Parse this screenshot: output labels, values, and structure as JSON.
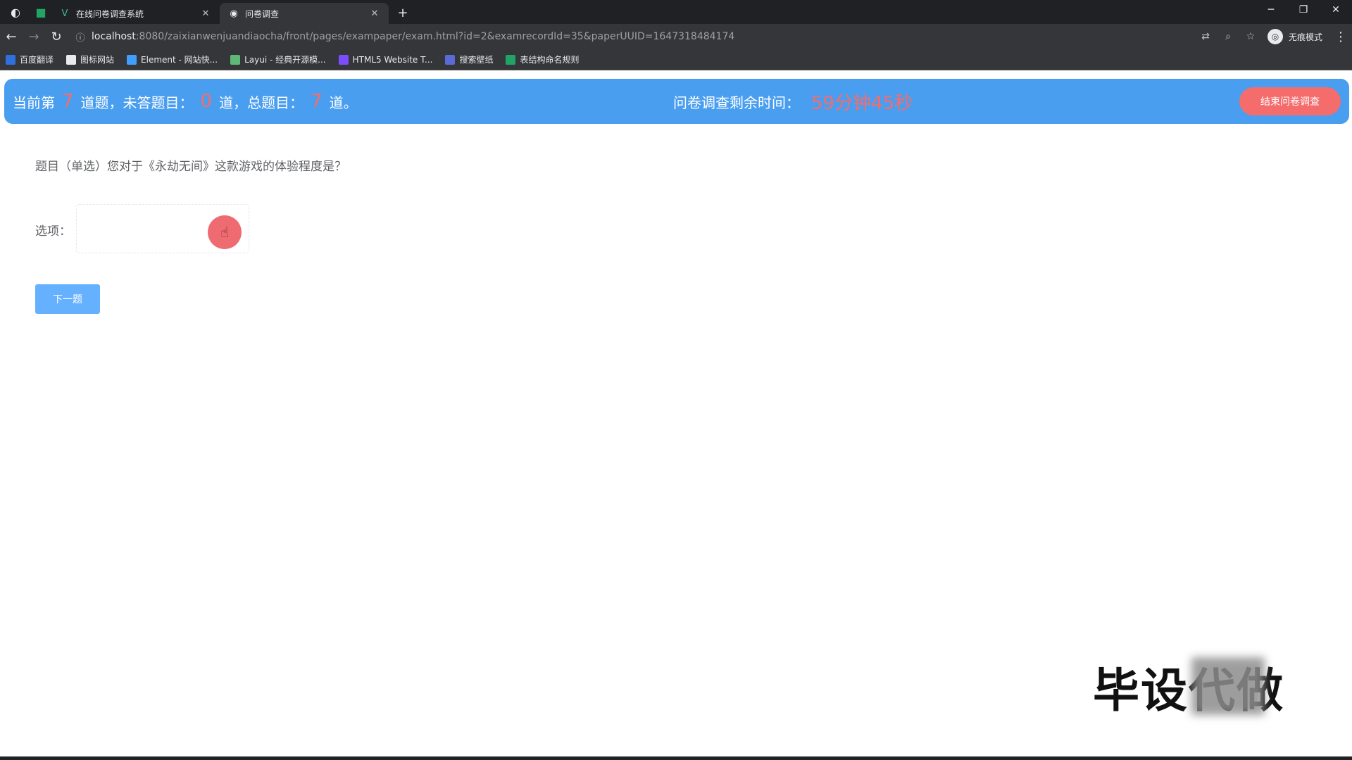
{
  "browser": {
    "tabs": [
      {
        "title": "在线问卷调查系统",
        "active": false
      },
      {
        "title": "问卷调查",
        "active": true
      }
    ],
    "url": {
      "host": "localhost",
      "path": ":8080/zaixianwenjuandiaocha/front/pages/exampaper/exam.html?id=2&examrecordId=35&paperUUID=1647318484174"
    },
    "incognito_label": "无痕模式",
    "bookmarks": [
      {
        "label": "百度翻译",
        "color": "#2f6fde"
      },
      {
        "label": "图标网站",
        "color": "#e8eaed"
      },
      {
        "label": "Element - 网站快...",
        "color": "#409eff"
      },
      {
        "label": "Layui - 经典开源模...",
        "color": "#5fb878"
      },
      {
        "label": "HTML5 Website T...",
        "color": "#7c4dff"
      },
      {
        "label": "搜索壁纸",
        "color": "#5b6bd6"
      },
      {
        "label": "表结构命名规则",
        "color": "#21a366"
      }
    ]
  },
  "exam": {
    "progress": {
      "prefix": "当前第",
      "current": "7",
      "mid1": "道题，未答题目：",
      "unanswered": "0",
      "mid2": "道，总题目：",
      "total": "7",
      "suffix": "道。"
    },
    "timer": {
      "label": "问卷调查剩余时间：",
      "value": "59分钟45秒"
    },
    "end_button": "结束问卷调查",
    "question_text": "题目（单选）您对于《永劫无间》这款游戏的体验程度是？",
    "options_label": "选项：",
    "next_button": "下一题"
  },
  "watermark": {
    "text": "毕设代做"
  },
  "colors": {
    "topbar": "#4a9ef0",
    "highlight": "#f56c6c",
    "next_button": "#66b1ff",
    "click_indicator": "#ef6b72"
  }
}
